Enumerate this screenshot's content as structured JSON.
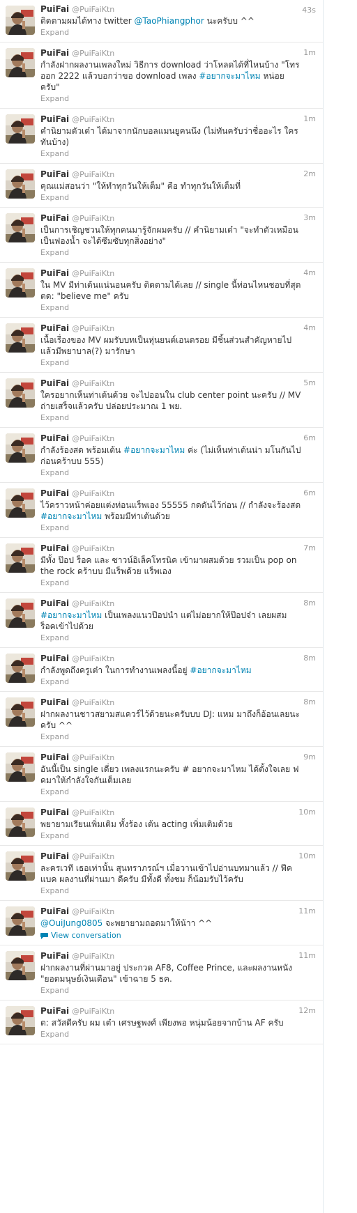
{
  "tweets": [
    {
      "name": "PuiFai",
      "handle": "@PuiFaiKtn",
      "time": "43s",
      "parts": [
        {
          "t": "ติดตามผมได้ทาง twitter "
        },
        {
          "t": "@TaoPhiangphor",
          "link": true
        },
        {
          "t": " นะครับบ ^^"
        }
      ],
      "action": "Expand"
    },
    {
      "name": "PuiFai",
      "handle": "@PuiFaiKtn",
      "time": "1m",
      "parts": [
        {
          "t": "กำลังฝากผลงานเพลงใหม่ วิธีการ download ว่าโหลดได้ที่ไหนบ้าง \"โทรออก 2222 แล้วบอกว่าขอ download เพลง "
        },
        {
          "t": "#อยากจะมาไหม",
          "link": true
        },
        {
          "t": " หน่อยครับ\""
        }
      ],
      "action": "Expand"
    },
    {
      "name": "PuiFai",
      "handle": "@PuiFaiKtn",
      "time": "1m",
      "parts": [
        {
          "t": "คำนิยามตัวเต๋า ได้มาจากนักบอลแมนยูคนนึง (ไม่ทันครับว่าชื่ออะไร ใครทันบ้าง)"
        }
      ],
      "action": "Expand"
    },
    {
      "name": "PuiFai",
      "handle": "@PuiFaiKtn",
      "time": "2m",
      "parts": [
        {
          "t": "คุณแม่สอนว่า \"ให้ทำทุกวันให้เต็ม\" คือ ทำทุกวันให้เต็มที่"
        }
      ],
      "action": "Expand"
    },
    {
      "name": "PuiFai",
      "handle": "@PuiFaiKtn",
      "time": "3m",
      "parts": [
        {
          "t": "เป็นการเชิญชวนให้ทุกคนมารู้จักผมครับ // คำนิยามเต๋า \"จะทำตัวเหมือนเป็นฟองน้ำ จะได้ซึมซับทุกสิ่งอย่าง\""
        }
      ],
      "action": "Expand"
    },
    {
      "name": "PuiFai",
      "handle": "@PuiFaiKtn",
      "time": "4m",
      "parts": [
        {
          "t": "ใน MV มีท่าเต้นแน่นอนครับ ติดตามได้เลย // single นี้ท่อนไหนชอบที่สุด ตด: \"believe me\" ครับ"
        }
      ],
      "action": "Expand"
    },
    {
      "name": "PuiFai",
      "handle": "@PuiFaiKtn",
      "time": "4m",
      "parts": [
        {
          "t": "เนื้อเรื่องของ MV ผมรับบทเป็นหุ่นยนต์เอนดรอย มีชิ้นส่วนสำคัญหายไป แล้วมีพยาบาล(?) มารักษา"
        }
      ],
      "action": "Expand"
    },
    {
      "name": "PuiFai",
      "handle": "@PuiFaiKtn",
      "time": "5m",
      "parts": [
        {
          "t": "ใครอยากเห็นท่าเต้นด้วย จะไปออนใน club center point นะครับ // MV ถ่ายเสร็จแล้วครับ ปล่อยประมาณ 1 พย."
        }
      ],
      "action": "Expand"
    },
    {
      "name": "PuiFai",
      "handle": "@PuiFaiKtn",
      "time": "6m",
      "parts": [
        {
          "t": "กำลังร้องสด พร้อมเต้น "
        },
        {
          "t": "#อยากจะมาไหม",
          "link": true
        },
        {
          "t": " ค่ะ (ไม่เห็นท่าเต้นน่า มโนกันไปก่อนคร้าบบ 555)"
        }
      ],
      "action": "Expand"
    },
    {
      "name": "PuiFai",
      "handle": "@PuiFaiKtn",
      "time": "6m",
      "parts": [
        {
          "t": "ไว้คราวหน้าค่อยแต่งท่อนแร็พเอง 55555 กดดันไว้ก่อน // กำลังจะร้องสด "
        },
        {
          "t": "#อยากจะมาไหม",
          "link": true
        },
        {
          "t": " พร้อมมีท่าเต้นด้วย"
        }
      ],
      "action": "Expand"
    },
    {
      "name": "PuiFai",
      "handle": "@PuiFaiKtn",
      "time": "7m",
      "parts": [
        {
          "t": "มีทั้ง ป๊อป ร็อค และ ซาวน์อิเล็คโทรนิค เข้ามาผสมด้วย รวมเป็น pop on the rock คร้าบบ มีแร็พด้วย แร็พเอง"
        }
      ],
      "action": "Expand"
    },
    {
      "name": "PuiFai",
      "handle": "@PuiFaiKtn",
      "time": "8m",
      "parts": [
        {
          "t": "#อยากจะมาไหม",
          "link": true
        },
        {
          "t": " เป็นเพลงแนวป๊อปนำ แต่ไม่อยากให้ป๊อปจ๋า เลยผสมร็อคเข้าไปด้วย"
        }
      ],
      "action": "Expand"
    },
    {
      "name": "PuiFai",
      "handle": "@PuiFaiKtn",
      "time": "8m",
      "parts": [
        {
          "t": "กำลังพูดถึงครูเต๋า ในการทำงานเพลงนี้อยู่ "
        },
        {
          "t": "#อยากจะมาไหม",
          "link": true
        }
      ],
      "action": "Expand"
    },
    {
      "name": "PuiFai",
      "handle": "@PuiFaiKtn",
      "time": "8m",
      "parts": [
        {
          "t": "ฝากผลงานชาวสยามสแควร์ไว้ด้วยนะครับบบ DJ: แหม มาถึงก็อ้อนเลยนะครับ ^^"
        }
      ],
      "action": "Expand"
    },
    {
      "name": "PuiFai",
      "handle": "@PuiFaiKtn",
      "time": "9m",
      "parts": [
        {
          "t": "อันนี้เป็น single เดี่ยว เพลงแรกนะครับ # อยากจะมาไหม ได้ตั้งใจเลย ฟคมาให้กำลังใจกันเต็มเลย"
        }
      ],
      "action": "Expand"
    },
    {
      "name": "PuiFai",
      "handle": "@PuiFaiKtn",
      "time": "10m",
      "parts": [
        {
          "t": "พยายามเรียนเพิ่มเติม ทั้งร้อง เต้น acting เพิ่มเติมด้วย"
        }
      ],
      "action": "Expand"
    },
    {
      "name": "PuiFai",
      "handle": "@PuiFaiKtn",
      "time": "10m",
      "parts": [
        {
          "t": "ละครเวที เธอเท่านั้น สุนทราภรณ์ฯ เมื่อวานเข้าไปอ่านบทมาแล้ว // ฟีคแบค ผลงานที่ผ่านมา ดีครับ มีทั้งดี ทั้งชม ก็น้อมรับไว้ครับ"
        }
      ],
      "action": "Expand"
    },
    {
      "name": "PuiFai",
      "handle": "@PuiFaiKtn",
      "time": "11m",
      "parts": [
        {
          "t": "@OuiJung0805",
          "link": true
        },
        {
          "t": " จะพยายามถอดมาให้น้าา ^^"
        }
      ],
      "action": "View conversation",
      "conversation": true
    },
    {
      "name": "PuiFai",
      "handle": "@PuiFaiKtn",
      "time": "11m",
      "parts": [
        {
          "t": "ฝากผลงานที่ผ่านมาอยู่ ประกวด AF8, Coffee Prince, และผลงานหนัง \"ยอดมนุษย์เงินเดือน\" เข้าฉาย 5 ธค."
        }
      ],
      "action": "Expand"
    },
    {
      "name": "PuiFai",
      "handle": "@PuiFaiKtn",
      "time": "12m",
      "parts": [
        {
          "t": "ต: สวัสดีครับ ผม เต๋า เศรษฐพงศ์ เพียงพอ หนุ่มน้อยจากบ้าน AF ครับ"
        }
      ],
      "action": "Expand"
    }
  ],
  "colors": {
    "link": "#0084b4",
    "meta": "#999999",
    "text": "#333333"
  }
}
